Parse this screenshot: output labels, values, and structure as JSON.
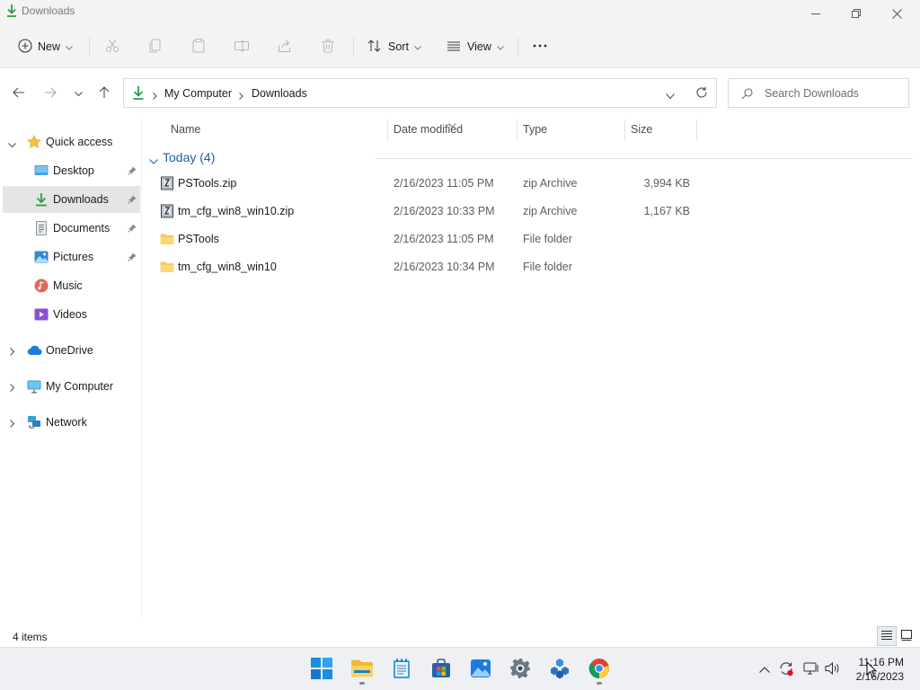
{
  "window": {
    "title": "Downloads"
  },
  "toolbar": {
    "new_label": "New",
    "sort_label": "Sort",
    "view_label": "View"
  },
  "address": {
    "crumbs": [
      "My Computer",
      "Downloads"
    ]
  },
  "search": {
    "placeholder": "Search Downloads"
  },
  "sidebar": {
    "items": [
      {
        "label": "Quick access",
        "icon": "star-icon"
      },
      {
        "label": "Desktop",
        "icon": "desktop-icon",
        "pinned": true
      },
      {
        "label": "Downloads",
        "icon": "download-icon",
        "pinned": true,
        "selected": true
      },
      {
        "label": "Documents",
        "icon": "documents-icon",
        "pinned": true
      },
      {
        "label": "Pictures",
        "icon": "pictures-icon",
        "pinned": true
      },
      {
        "label": "Music",
        "icon": "music-icon"
      },
      {
        "label": "Videos",
        "icon": "videos-icon"
      },
      {
        "label": "OneDrive",
        "icon": "cloud-icon"
      },
      {
        "label": "My Computer",
        "icon": "computer-icon"
      },
      {
        "label": "Network",
        "icon": "network-icon"
      }
    ]
  },
  "columns": {
    "name": "Name",
    "date": "Date modified",
    "type": "Type",
    "size": "Size"
  },
  "group": {
    "label": "Today (4)"
  },
  "files": [
    {
      "name": "PSTools.zip",
      "date": "2/16/2023 11:05 PM",
      "type": "zip Archive",
      "size": "3,994 KB",
      "icon": "zip-icon"
    },
    {
      "name": "tm_cfg_win8_win10.zip",
      "date": "2/16/2023 10:33 PM",
      "type": "zip Archive",
      "size": "1,167 KB",
      "icon": "zip-icon"
    },
    {
      "name": "PSTools",
      "date": "2/16/2023 11:05 PM",
      "type": "File folder",
      "size": "",
      "icon": "folder-icon"
    },
    {
      "name": "tm_cfg_win8_win10",
      "date": "2/16/2023 10:34 PM",
      "type": "File folder",
      "size": "",
      "icon": "folder-icon"
    }
  ],
  "status": {
    "item_count": "4 items"
  },
  "taskbar": {
    "time": "11:16 PM",
    "date": "2/16/2023"
  },
  "colors": {
    "accent": "#0067c0",
    "folder": "#f8c955",
    "download_green": "#2a9d4a",
    "group_header": "#1d5ea8"
  }
}
